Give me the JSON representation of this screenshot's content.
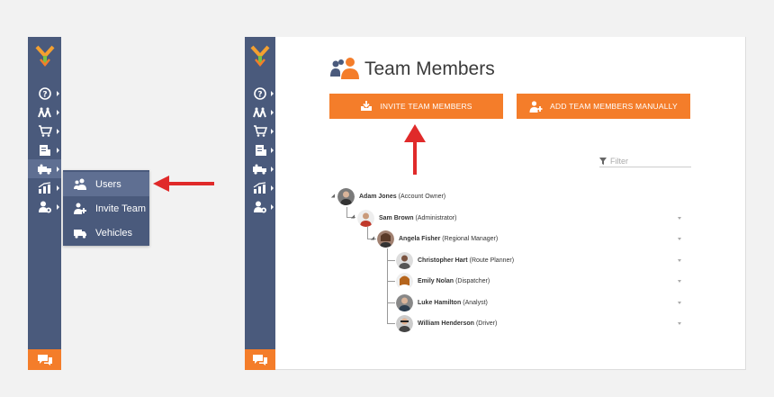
{
  "popup_menu": {
    "items": [
      {
        "label": "Users",
        "icon": "users-icon",
        "active": true
      },
      {
        "label": "Invite Team",
        "icon": "invite-team-icon",
        "active": false
      },
      {
        "label": "Vehicles",
        "icon": "truck-icon",
        "active": false
      }
    ]
  },
  "sidebar": {
    "logo": "route4me-logo",
    "items": [
      "help-icon",
      "routes-icon",
      "cart-icon",
      "documents-icon",
      "team-icon",
      "analytics-icon",
      "settings-icon"
    ],
    "chat_icon": "chat-icon"
  },
  "main": {
    "title": "Team Members",
    "invite_button": "INVITE TEAM MEMBERS",
    "add_button": "ADD TEAM MEMBERS MANUALLY",
    "filter_placeholder": "Filter"
  },
  "tree": [
    {
      "name": "Adam Jones",
      "role": "(Account Owner)",
      "level": 0
    },
    {
      "name": "Sam Brown",
      "role": "(Administrator)",
      "level": 1
    },
    {
      "name": "Angela Fisher",
      "role": "(Regional Manager)",
      "level": 2
    },
    {
      "name": "Christopher Hart",
      "role": "(Route Planner)",
      "level": 3
    },
    {
      "name": "Emily Nolan",
      "role": "(Dispatcher)",
      "level": 3
    },
    {
      "name": "Luke Hamilton",
      "role": "(Analyst)",
      "level": 3
    },
    {
      "name": "William Henderson",
      "role": "(Driver)",
      "level": 3
    }
  ],
  "colors": {
    "sidebar": "#4a5a7c",
    "accent": "#f47d2a",
    "arrow": "#e02a2a"
  }
}
